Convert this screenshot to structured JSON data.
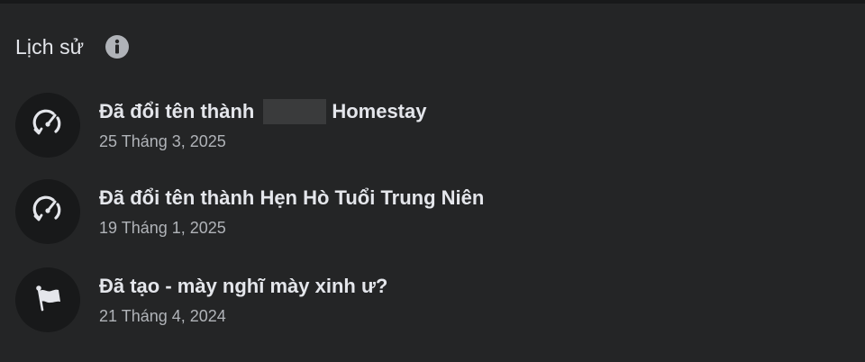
{
  "header": {
    "title": "Lịch sử",
    "info_icon": "info-icon"
  },
  "history": {
    "items": [
      {
        "icon": "gauge-icon",
        "title_prefix": "Đã đổi tên thành",
        "title_suffix": "Homestay",
        "has_redacted": true,
        "date": "25 Tháng 3, 2025"
      },
      {
        "icon": "gauge-icon",
        "title": "Đã đổi tên thành Hẹn Hò Tuổi Trung Niên",
        "date": "19 Tháng 1, 2025"
      },
      {
        "icon": "flag-icon",
        "title": "Đã tạo - mày nghĩ mày xinh ư?",
        "date": "21 Tháng 4, 2024"
      }
    ]
  },
  "colors": {
    "background": "#242526",
    "icon_circle": "#18191a",
    "text_primary": "#e4e6eb",
    "text_secondary": "#b0b3b8"
  }
}
